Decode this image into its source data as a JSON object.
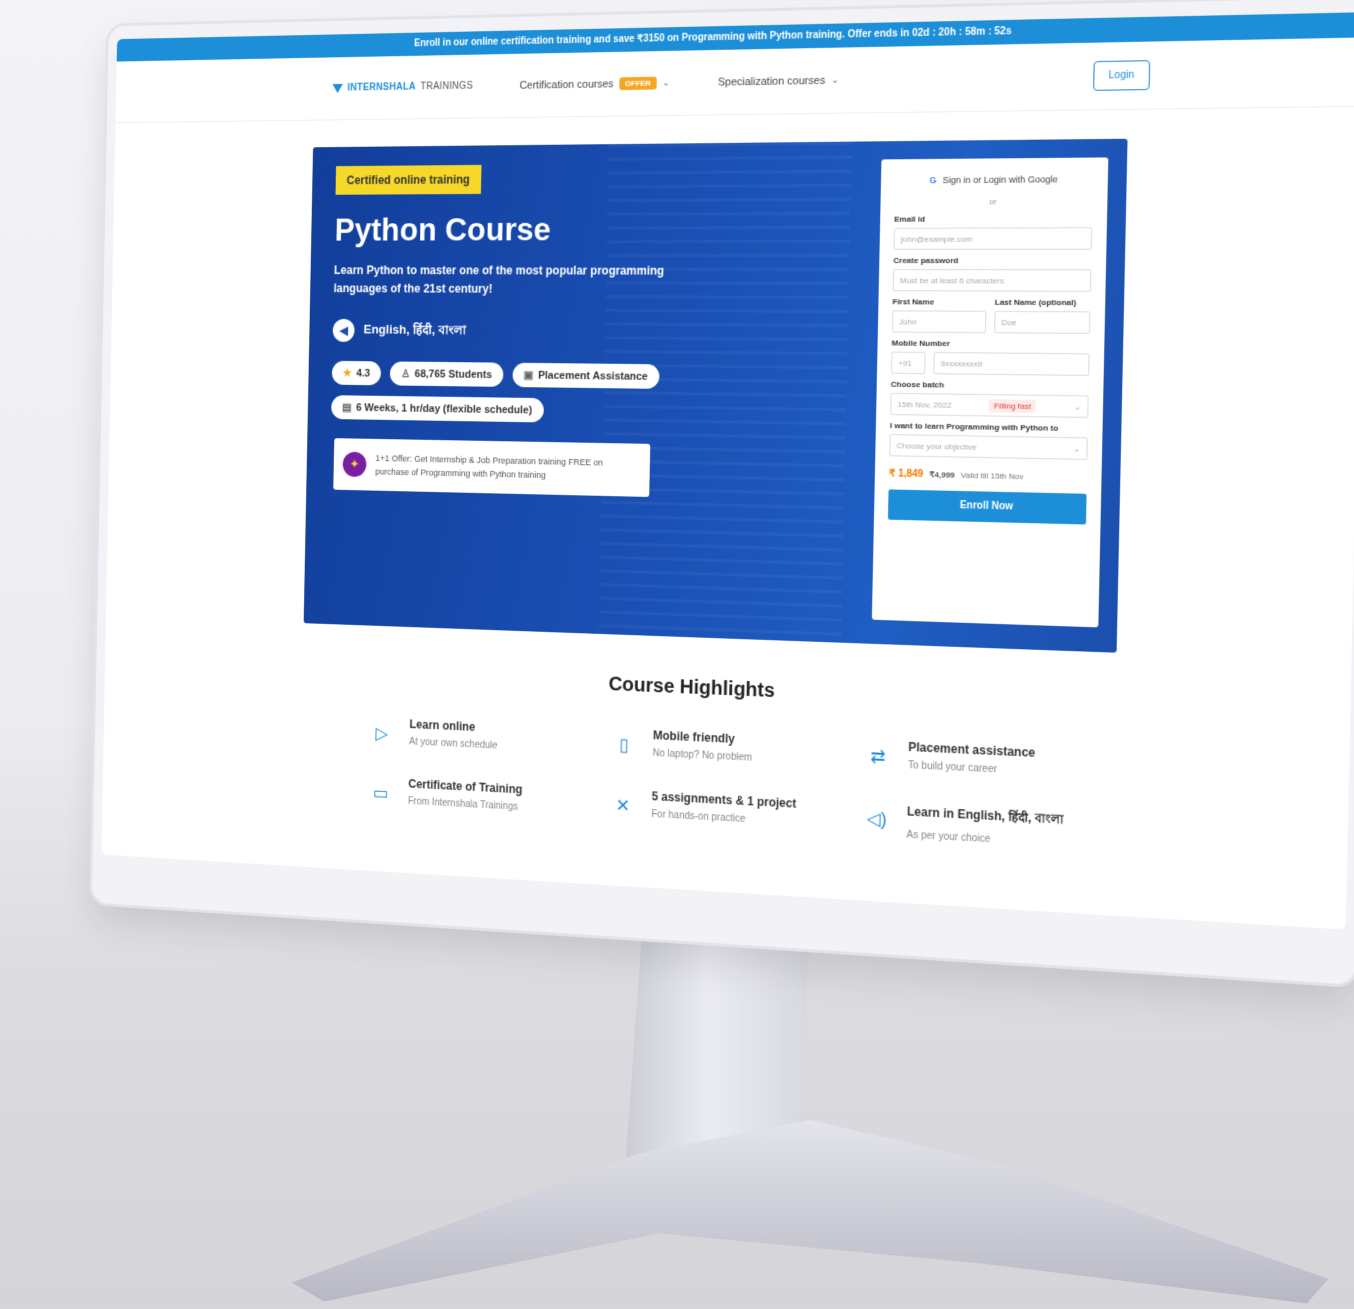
{
  "promo": {
    "text": "Enroll in our online certification training and save ₹3150 on Programming with Python training. Offer ends in 02d : 20h : 58m : 52s"
  },
  "nav": {
    "logo_main": "INTERNSHALA",
    "logo_sub": "TRAININGS",
    "certification_label": "Certification courses",
    "certification_badge": "OFFER",
    "specialization_label": "Specialization courses",
    "login_label": "Login"
  },
  "hero": {
    "tag": "Certified online training",
    "title": "Python Course",
    "subtitle": "Learn Python to master one of the most popular programming languages of the 21st century!",
    "languages": "English, हिंदी, বাংলা",
    "rating": "4.3",
    "students": "68,765 Students",
    "placement": "Placement Assistance",
    "duration": "6 Weeks, 1 hr/day (flexible schedule)",
    "offer_text": "1+1 Offer: Get Internship & Job Preparation training FREE on purchase of Programming with Python training"
  },
  "form": {
    "google_label": "Sign in or Login with Google",
    "or_label": "or",
    "email_label": "Email id",
    "email_placeholder": "john@example.com",
    "password_label": "Create password",
    "password_placeholder": "Must be at least 6 characters",
    "first_name_label": "First Name",
    "first_name_placeholder": "John",
    "last_name_label": "Last Name (optional)",
    "last_name_placeholder": "Doe",
    "mobile_label": "Mobile Number",
    "mobile_code": "+91",
    "mobile_placeholder": "9xxxxxxxx9",
    "batch_label": "Choose batch",
    "batch_value": "15th Nov, 2022",
    "batch_status": "Filling fast",
    "reason_label": "I want to learn Programming with Python to",
    "reason_placeholder": "Choose your objective",
    "price": "₹ 1,849",
    "price_old": "₹4,999",
    "price_valid": "Valid till 15th Nov",
    "enroll_label": "Enroll Now"
  },
  "highlights": {
    "title": "Course Highlights",
    "items": [
      {
        "title": "Learn online",
        "sub": "At your own schedule",
        "icon": "play-circle-icon"
      },
      {
        "title": "Mobile friendly",
        "sub": "No laptop? No problem",
        "icon": "mobile-icon"
      },
      {
        "title": "Placement assistance",
        "sub": "To build your career",
        "icon": "handshake-icon"
      },
      {
        "title": "Certificate of Training",
        "sub": "From Internshala Trainings",
        "icon": "certificate-icon"
      },
      {
        "title": "5 assignments & 1 project",
        "sub": "For hands-on practice",
        "icon": "tools-icon"
      },
      {
        "title": "Learn in English, हिंदी, বাংলা",
        "sub": "As per your choice",
        "icon": "speaker-icon"
      }
    ]
  }
}
